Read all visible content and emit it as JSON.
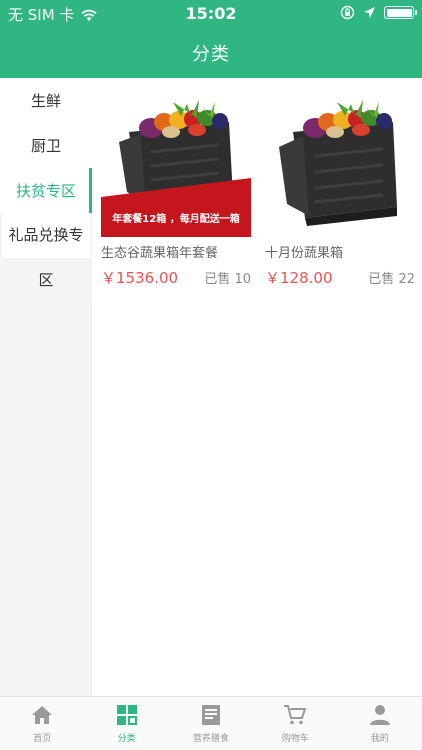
{
  "status_bar": {
    "carrier": "无 SIM 卡",
    "time": "15:02"
  },
  "header": {
    "title": "分类"
  },
  "sidebar": {
    "items": [
      {
        "label": "生鲜"
      },
      {
        "label": "厨卫"
      },
      {
        "label": "扶贫专区",
        "active": true
      },
      {
        "label_line1": "礼品兑换专",
        "label_line2": "区"
      }
    ]
  },
  "products": [
    {
      "name": "生态谷蔬果箱年套餐",
      "price": "￥1536.00",
      "sold": "已售 10",
      "banner": "年套餐12箱 ，每月配送一箱"
    },
    {
      "name": "十月份蔬果箱",
      "price": "￥128.00",
      "sold": "已售 22"
    }
  ],
  "tabbar": {
    "items": [
      {
        "label": "首页",
        "icon": "home-icon"
      },
      {
        "label": "分类",
        "icon": "category-grid-icon",
        "active": true
      },
      {
        "label": "营养膳食",
        "icon": "document-icon"
      },
      {
        "label": "购物车",
        "icon": "cart-icon"
      },
      {
        "label": "我的",
        "icon": "user-icon"
      }
    ]
  },
  "colors": {
    "accent": "#2fb682",
    "price": "#e85454",
    "banner": "#c4161c"
  }
}
